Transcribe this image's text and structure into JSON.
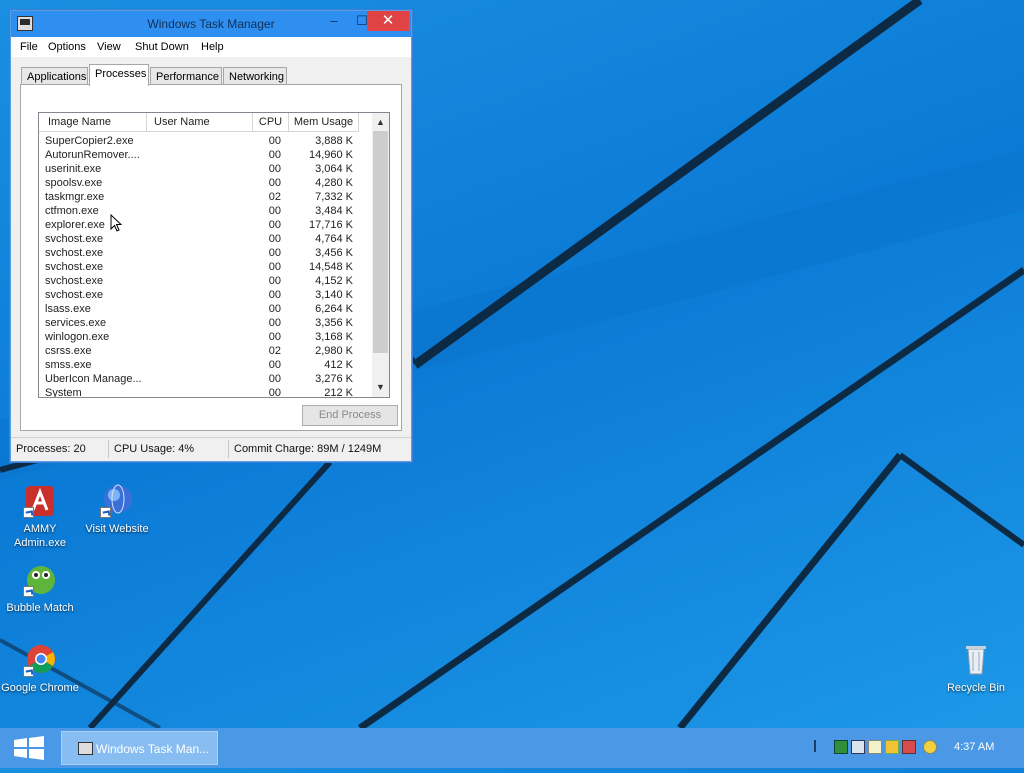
{
  "window": {
    "title": "Windows Task Manager",
    "controls": {
      "minimize": "–",
      "maximize": "☐",
      "close": "✕"
    }
  },
  "menu": [
    "File",
    "Options",
    "View",
    "Shut Down",
    "Help"
  ],
  "tabs": [
    {
      "label": "Applications",
      "active": false
    },
    {
      "label": "Processes",
      "active": true
    },
    {
      "label": "Performance",
      "active": false
    },
    {
      "label": "Networking",
      "active": false
    }
  ],
  "processes": {
    "columns": [
      "Image Name",
      "User Name",
      "CPU",
      "Mem Usage"
    ],
    "rows": [
      {
        "name": "SuperCopier2.exe",
        "cpu": "00",
        "mem": "3,888 K"
      },
      {
        "name": "AutorunRemover....",
        "cpu": "00",
        "mem": "14,960 K"
      },
      {
        "name": "userinit.exe",
        "cpu": "00",
        "mem": "3,064 K"
      },
      {
        "name": "spoolsv.exe",
        "cpu": "00",
        "mem": "4,280 K"
      },
      {
        "name": "taskmgr.exe",
        "cpu": "02",
        "mem": "7,332 K"
      },
      {
        "name": "ctfmon.exe",
        "cpu": "00",
        "mem": "3,484 K"
      },
      {
        "name": "explorer.exe",
        "cpu": "00",
        "mem": "17,716 K"
      },
      {
        "name": "svchost.exe",
        "cpu": "00",
        "mem": "4,764 K"
      },
      {
        "name": "svchost.exe",
        "cpu": "00",
        "mem": "3,456 K"
      },
      {
        "name": "svchost.exe",
        "cpu": "00",
        "mem": "14,548 K"
      },
      {
        "name": "svchost.exe",
        "cpu": "00",
        "mem": "4,152 K"
      },
      {
        "name": "svchost.exe",
        "cpu": "00",
        "mem": "3,140 K"
      },
      {
        "name": "lsass.exe",
        "cpu": "00",
        "mem": "6,264 K"
      },
      {
        "name": "services.exe",
        "cpu": "00",
        "mem": "3,356 K"
      },
      {
        "name": "winlogon.exe",
        "cpu": "00",
        "mem": "3,168 K"
      },
      {
        "name": "csrss.exe",
        "cpu": "02",
        "mem": "2,980 K"
      },
      {
        "name": "smss.exe",
        "cpu": "00",
        "mem": "412 K"
      },
      {
        "name": "UberIcon Manage...",
        "cpu": "00",
        "mem": "3,276 K"
      },
      {
        "name": "System",
        "cpu": "00",
        "mem": "212 K"
      }
    ]
  },
  "buttons": {
    "end_process": "End Process"
  },
  "status": {
    "processes": "Processes: 20",
    "cpu": "CPU Usage: 4%",
    "commit": "Commit Charge: 89M / 1249M"
  },
  "desktop_icons": [
    {
      "label": "AMMY Admin.exe",
      "icon": "ammy-admin-icon"
    },
    {
      "label": "Visit Website",
      "icon": "globe-icon"
    },
    {
      "label": "Bubble Match",
      "icon": "bubble-match-icon"
    },
    {
      "label": "Google Chrome",
      "icon": "chrome-icon"
    },
    {
      "label": "Recycle Bin",
      "icon": "recycle-bin-icon"
    }
  ],
  "taskbar": {
    "task_label": "Windows Task Man...",
    "clock": "4:37 AM"
  },
  "colors": {
    "accent": "#2e8ff0",
    "close": "#e04343",
    "taskbar": "#4b98e6"
  }
}
